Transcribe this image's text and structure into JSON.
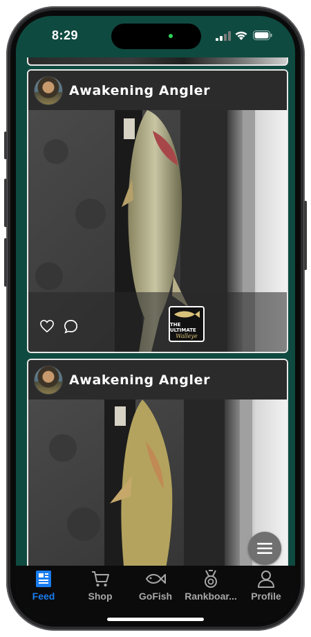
{
  "status_bar": {
    "time": "8:29"
  },
  "feed": {
    "posts": [
      {
        "username": "Awakening Angler",
        "badge": {
          "line1": "THE ULTIMATE",
          "line2": "Walleye"
        }
      },
      {
        "username": "Awakening Angler"
      }
    ]
  },
  "tabbar": {
    "active": "Feed",
    "accent_color": "#1a7df0",
    "items": [
      {
        "label": "Feed",
        "icon": "newspaper-icon"
      },
      {
        "label": "Shop",
        "icon": "cart-icon"
      },
      {
        "label": "GoFish",
        "icon": "fish-icon"
      },
      {
        "label": "Rankboar...",
        "icon": "medal-icon"
      },
      {
        "label": "Profile",
        "icon": "person-icon"
      }
    ]
  },
  "fab": {
    "icon": "menu-icon"
  }
}
